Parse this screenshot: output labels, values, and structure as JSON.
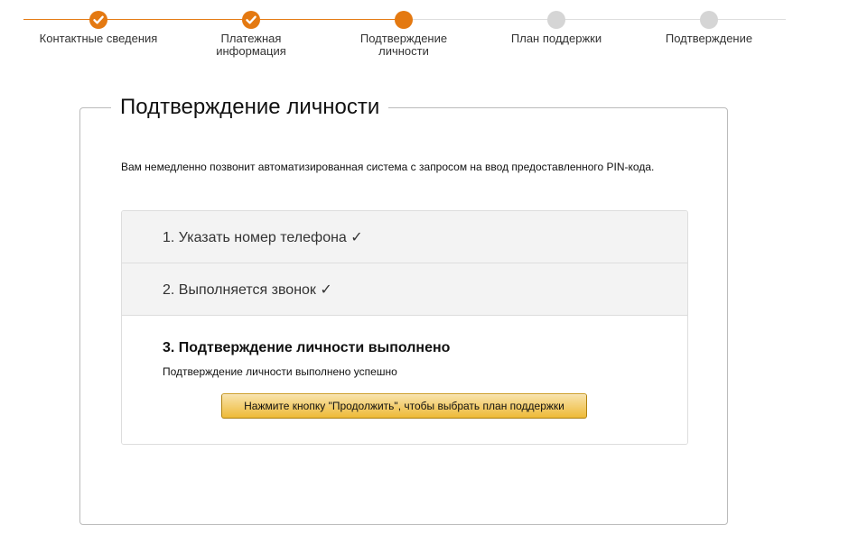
{
  "colors": {
    "accent": "#e47911",
    "inactive_step": "#d5d5d5",
    "button_top": "#f8e3ad",
    "button_bottom": "#eeba37"
  },
  "progress": {
    "current_step": 3,
    "total_steps": 5,
    "steps": [
      {
        "label": "Контактные сведения",
        "state": "done",
        "icon": "check-icon"
      },
      {
        "label": "Платежная\nинформация",
        "state": "done",
        "icon": "check-icon"
      },
      {
        "label": "Подтверждение\nличности",
        "state": "current"
      },
      {
        "label": "План поддержки",
        "state": "todo"
      },
      {
        "label": "Подтверждение",
        "state": "todo"
      }
    ]
  },
  "panel": {
    "title": "Подтверждение личности",
    "intro": "Вам немедленно позвонит автоматизированная система с запросом на ввод предоставленного PIN-кода.",
    "steps": [
      {
        "label": "1. Указать номер телефона ✓",
        "state": "completed"
      },
      {
        "label": "2. Выполняется звонок ✓",
        "state": "completed"
      }
    ],
    "active_step": {
      "title": "3. Подтверждение личности выполнено",
      "description": "Подтверждение личности выполнено успешно",
      "button_label": "Нажмите кнопку \"Продолжить\", чтобы выбрать план поддержки"
    }
  }
}
